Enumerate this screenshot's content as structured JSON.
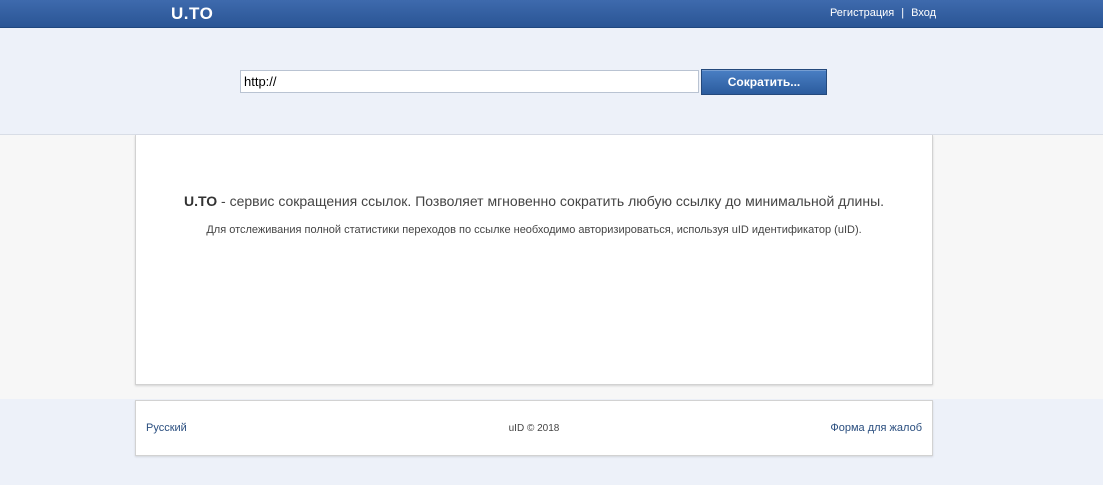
{
  "header": {
    "logo": "U.TO",
    "register_label": "Регистрация",
    "separator": "|",
    "login_label": "Вход"
  },
  "shortener": {
    "url_value": "http://",
    "button_label": "Сократить..."
  },
  "content": {
    "brand": "U.TO",
    "description": "- сервис сокращения ссылок. Позволяет мгновенно сократить любую ссылку до минимальной длины.",
    "note": "Для отслеживания полной статистики переходов по ссылке необходимо авторизироваться, используя uID идентификатор (uID)."
  },
  "footer": {
    "language_label": "Русский",
    "copyright": "uID © 2018",
    "complaint_label": "Форма для жалоб"
  },
  "colors": {
    "header_bg": "#2f5c9e",
    "page_bg": "#edf1f9",
    "link": "#2a4e7f"
  }
}
